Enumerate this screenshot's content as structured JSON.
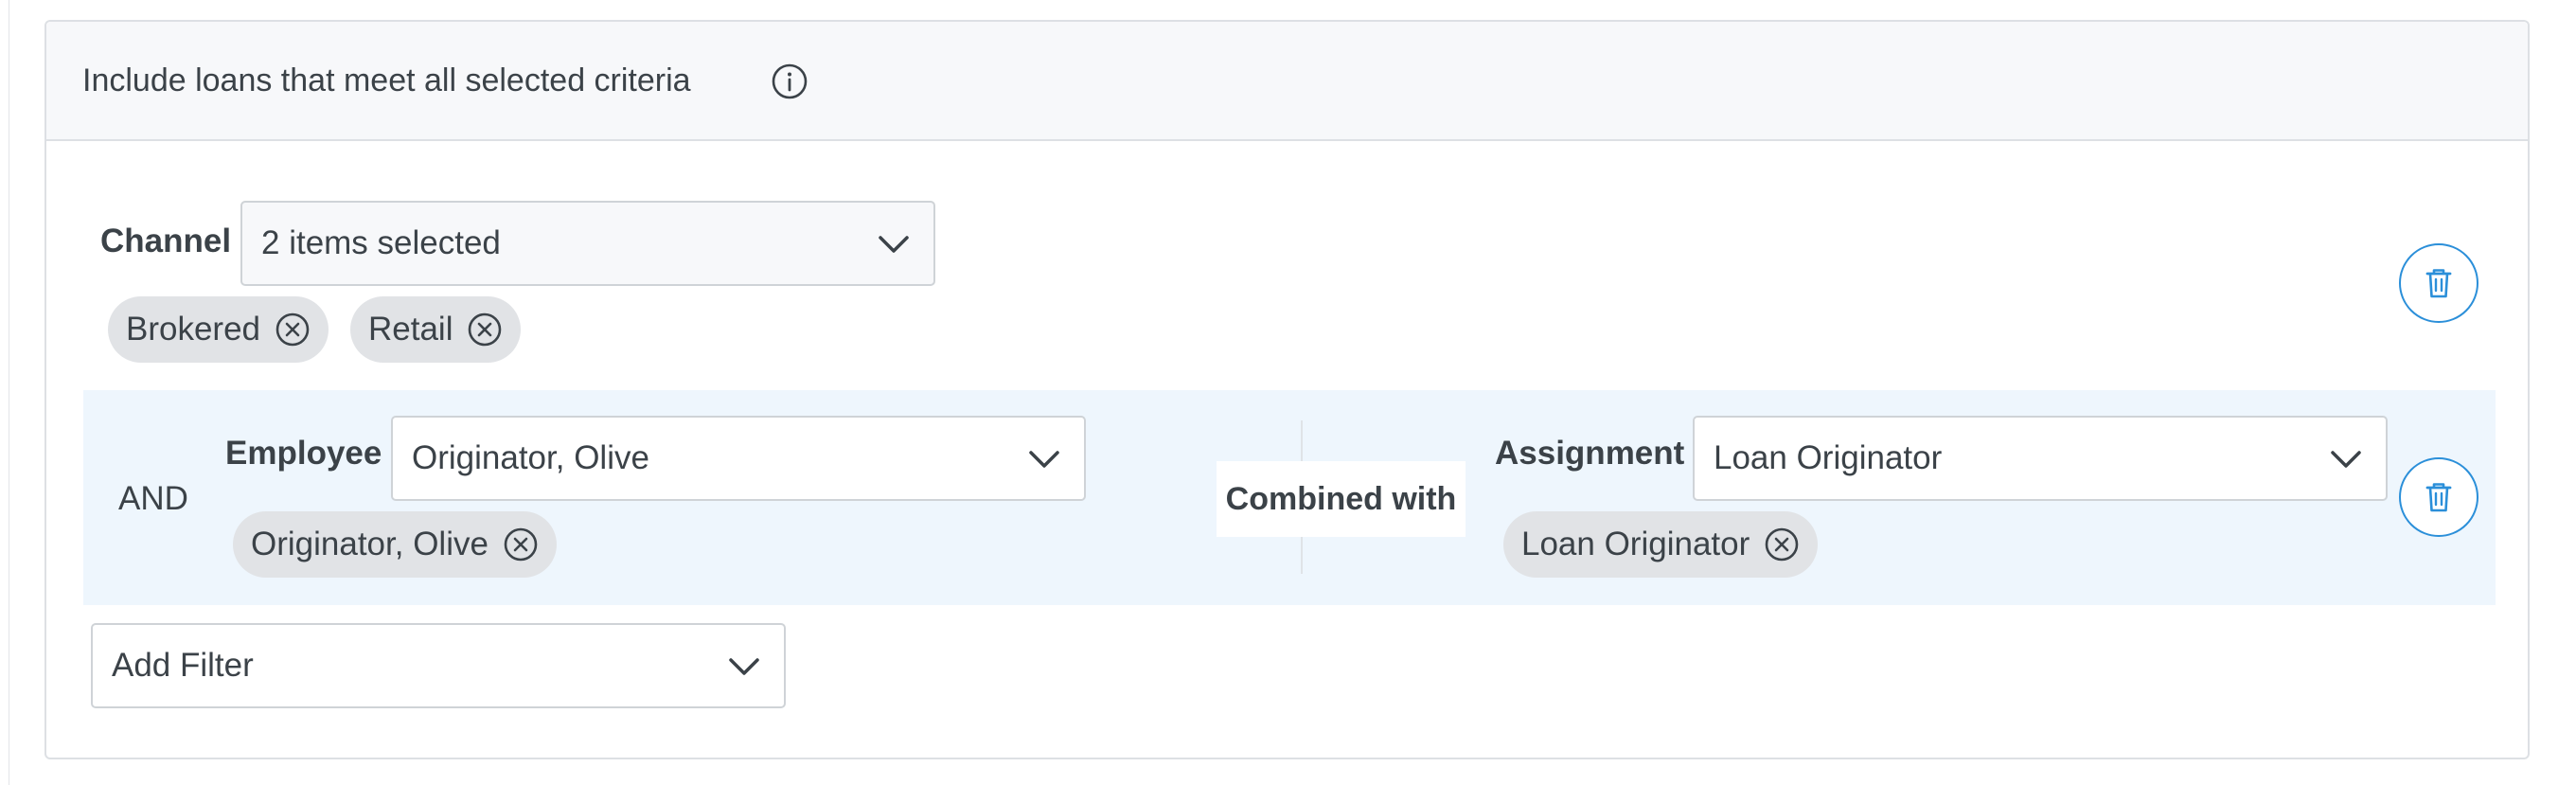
{
  "panel": {
    "header_title": "Include loans that meet all selected criteria"
  },
  "channel_filter": {
    "label": "Channel",
    "select_value": "2 items selected",
    "chips": [
      "Brokered",
      "Retail"
    ]
  },
  "combined_group": {
    "operator": "AND",
    "combined_label": "Combined with",
    "employee": {
      "label": "Employee",
      "select_value": "Originator, Olive",
      "chips": [
        "Originator, Olive"
      ]
    },
    "assignment": {
      "label": "Assignment",
      "select_value": "Loan Originator",
      "chips": [
        "Loan Originator"
      ]
    }
  },
  "add_filter": {
    "select_value": "Add Filter"
  },
  "icons": {
    "info": "info-circle-icon",
    "chevron": "chevron-down-icon",
    "chip_remove": "close-circle-icon",
    "delete": "trash-icon"
  },
  "colors": {
    "accent": "#2b8fd9",
    "group_background": "#eef6fd",
    "chip_background": "#e1e3e6",
    "header_background": "#f7f8fa"
  }
}
